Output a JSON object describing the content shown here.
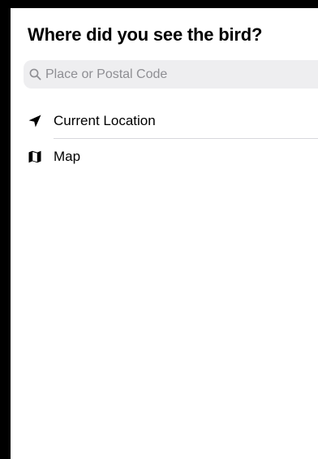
{
  "header": {
    "title": "Where did you see the bird?"
  },
  "search": {
    "placeholder": "Place or Postal Code",
    "icon": "magnifying-glass-icon"
  },
  "options": [
    {
      "label": "Current Location",
      "icon": "location-arrow-icon"
    },
    {
      "label": "Map",
      "icon": "map-icon"
    }
  ],
  "colors": {
    "background": "#ffffff",
    "search_background": "#eeeef0",
    "placeholder": "#8e8e93",
    "separator": "#d8d8dc",
    "chevron": "#c4c4c8"
  }
}
